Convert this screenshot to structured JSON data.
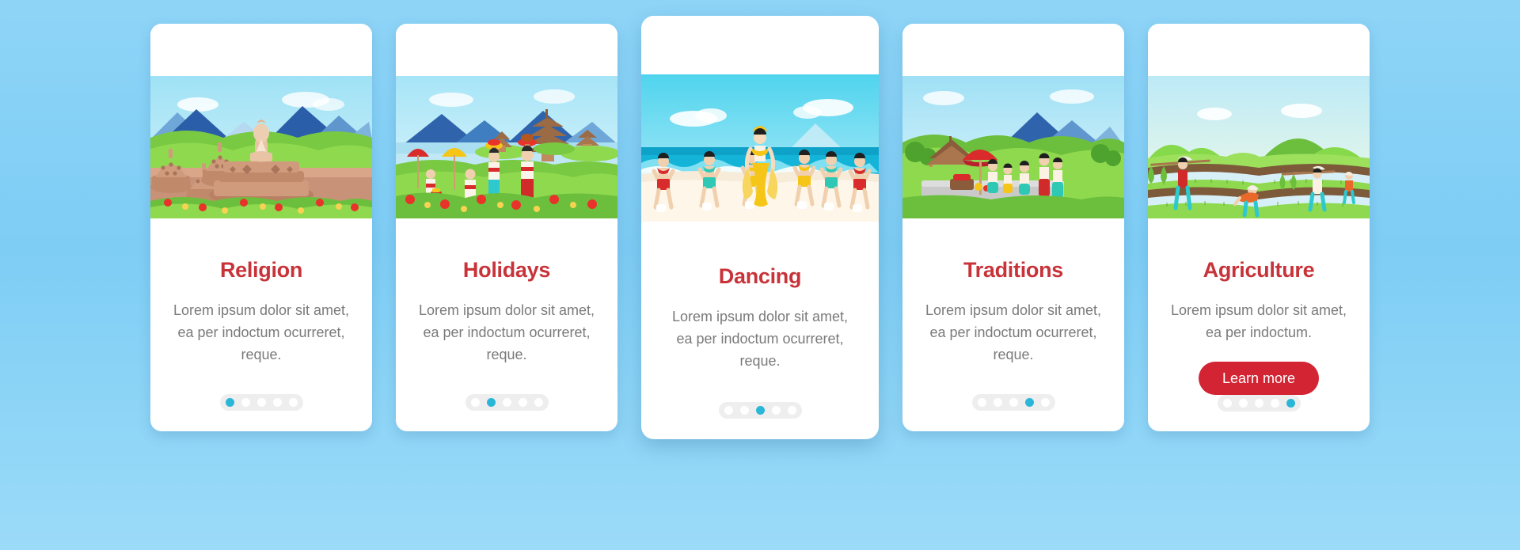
{
  "page": {
    "background_color": "#7ecdf5",
    "title_color": "#c8333a",
    "body_text_color": "#7a7a7a",
    "accent_dot_color": "#29b6d8",
    "button_color": "#d32434"
  },
  "cards": [
    {
      "id": "religion",
      "title": "Religion",
      "description": "Lorem ipsum dolor sit amet, ea per indoctum ocurreret, reque.",
      "illustration": "borobudur-temple-buddha-stupas",
      "featured": false,
      "button": null,
      "pager": {
        "total": 5,
        "active_index": 0
      }
    },
    {
      "id": "holidays",
      "title": "Holidays",
      "description": "Lorem ipsum dolor sit amet, ea per indoctum ocurreret, reque.",
      "illustration": "balinese-procession-lake-temple",
      "featured": false,
      "button": null,
      "pager": {
        "total": 5,
        "active_index": 1
      }
    },
    {
      "id": "dancing",
      "title": "Dancing",
      "description": "Lorem ipsum dolor sit amet, ea per indoctum ocurreret, reque.",
      "illustration": "beach-kecak-dancers",
      "featured": true,
      "button": null,
      "pager": {
        "total": 5,
        "active_index": 2
      }
    },
    {
      "id": "traditions",
      "title": "Traditions",
      "description": "Lorem ipsum dolor sit amet, ea per indoctum ocurreret, reque.",
      "illustration": "village-ceremony-pavilion",
      "featured": false,
      "button": null,
      "pager": {
        "total": 5,
        "active_index": 3
      }
    },
    {
      "id": "agriculture",
      "title": "Agriculture",
      "description": "Lorem ipsum dolor sit amet, ea per indoctum.",
      "illustration": "rice-terrace-farmers",
      "featured": false,
      "button": {
        "label": "Learn more"
      },
      "pager": {
        "total": 5,
        "active_index": 4
      }
    }
  ]
}
